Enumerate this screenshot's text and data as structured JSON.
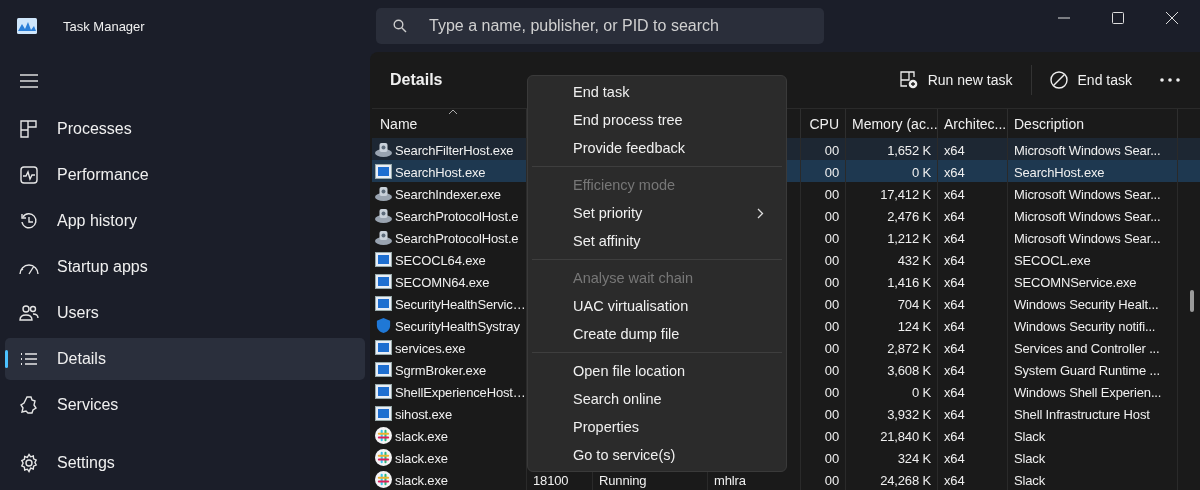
{
  "window": {
    "title": "Task Manager"
  },
  "search": {
    "placeholder": "Type a name, publisher, or PID to search"
  },
  "sidebar": {
    "items": [
      {
        "label": "Processes",
        "selected": false
      },
      {
        "label": "Performance",
        "selected": false
      },
      {
        "label": "App history",
        "selected": false
      },
      {
        "label": "Startup apps",
        "selected": false
      },
      {
        "label": "Users",
        "selected": false
      },
      {
        "label": "Details",
        "selected": true
      },
      {
        "label": "Services",
        "selected": false
      }
    ],
    "footer": {
      "label": "Settings"
    }
  },
  "page": {
    "title": "Details",
    "actions": [
      {
        "label": "Run new task"
      },
      {
        "label": "End task"
      }
    ]
  },
  "table": {
    "headers": {
      "name": {
        "label": "Name",
        "sorted": true
      },
      "cpu": {
        "label": "CPU"
      },
      "memory": {
        "label": "Memory (ac..."
      },
      "arch": {
        "label": "Architec..."
      },
      "description": {
        "label": "Description"
      }
    },
    "rows": [
      {
        "kind": "service",
        "name": "SearchFilterHost.exe",
        "cpu": "00",
        "memory": "1,652 K",
        "arch": "x64",
        "description": "Microsoft Windows Sear...",
        "selected": false,
        "hovered": true
      },
      {
        "kind": "window",
        "name": "SearchHost.exe",
        "cpu": "00",
        "memory": "0 K",
        "arch": "x64",
        "description": "SearchHost.exe",
        "selected": true,
        "hovered": false
      },
      {
        "kind": "service",
        "name": "SearchIndexer.exe",
        "cpu": "00",
        "memory": "17,412 K",
        "arch": "x64",
        "description": "Microsoft Windows Sear...",
        "selected": false,
        "hovered": false
      },
      {
        "kind": "service",
        "name": "SearchProtocolHost.e",
        "cpu": "00",
        "memory": "2,476 K",
        "arch": "x64",
        "description": "Microsoft Windows Sear...",
        "selected": false,
        "hovered": false
      },
      {
        "kind": "service",
        "name": "SearchProtocolHost.e",
        "cpu": "00",
        "memory": "1,212 K",
        "arch": "x64",
        "description": "Microsoft Windows Sear...",
        "selected": false,
        "hovered": false
      },
      {
        "kind": "window",
        "name": "SECOCL64.exe",
        "cpu": "00",
        "memory": "432 K",
        "arch": "x64",
        "description": "SECOCL.exe",
        "selected": false,
        "hovered": false
      },
      {
        "kind": "window",
        "name": "SECOMN64.exe",
        "cpu": "00",
        "memory": "1,416 K",
        "arch": "x64",
        "description": "SECOMNService.exe",
        "selected": false,
        "hovered": false
      },
      {
        "kind": "window",
        "name": "SecurityHealthServic…",
        "cpu": "00",
        "memory": "704 K",
        "arch": "x64",
        "description": "Windows Security Healt...",
        "selected": false,
        "hovered": false
      },
      {
        "kind": "shield",
        "name": "SecurityHealthSystray",
        "cpu": "00",
        "memory": "124 K",
        "arch": "x64",
        "description": "Windows Security notifi...",
        "selected": false,
        "hovered": false
      },
      {
        "kind": "window",
        "name": "services.exe",
        "cpu": "00",
        "memory": "2,872 K",
        "arch": "x64",
        "description": "Services and Controller ...",
        "selected": false,
        "hovered": false
      },
      {
        "kind": "window",
        "name": "SgrmBroker.exe",
        "cpu": "00",
        "memory": "3,608 K",
        "arch": "x64",
        "description": "System Guard Runtime ...",
        "selected": false,
        "hovered": false
      },
      {
        "kind": "window",
        "name": "ShellExperienceHost…",
        "cpu": "00",
        "memory": "0 K",
        "arch": "x64",
        "description": "Windows Shell Experien...",
        "selected": false,
        "hovered": false
      },
      {
        "kind": "window",
        "name": "sihost.exe",
        "cpu": "00",
        "memory": "3,932 K",
        "arch": "x64",
        "description": "Shell Infrastructure Host",
        "selected": false,
        "hovered": false
      },
      {
        "kind": "slack",
        "name": "slack.exe",
        "cpu": "00",
        "memory": "21,840 K",
        "arch": "x64",
        "description": "Slack",
        "selected": false,
        "hovered": false
      },
      {
        "kind": "slack",
        "name": "slack.exe",
        "cpu": "00",
        "memory": "324 K",
        "arch": "x64",
        "description": "Slack",
        "selected": false,
        "hovered": false
      },
      {
        "kind": "slack",
        "name": "slack.exe",
        "pid": "18100",
        "status": "Running",
        "user": "mhlra",
        "cpu": "00",
        "memory": "24,268 K",
        "arch": "x64",
        "description": "Slack",
        "selected": false,
        "hovered": false
      }
    ]
  },
  "context_menu": {
    "items": [
      {
        "kind": "item",
        "label": "End task",
        "disabled": false,
        "submenu": false
      },
      {
        "kind": "item",
        "label": "End process tree",
        "disabled": false,
        "submenu": false
      },
      {
        "kind": "item",
        "label": "Provide feedback",
        "disabled": false,
        "submenu": false
      },
      {
        "kind": "separator"
      },
      {
        "kind": "item",
        "label": "Efficiency mode",
        "disabled": true,
        "submenu": false
      },
      {
        "kind": "item",
        "label": "Set priority",
        "disabled": false,
        "submenu": true
      },
      {
        "kind": "item",
        "label": "Set affinity",
        "disabled": false,
        "submenu": false
      },
      {
        "kind": "separator"
      },
      {
        "kind": "item",
        "label": "Analyse wait chain",
        "disabled": true,
        "submenu": false
      },
      {
        "kind": "item",
        "label": "UAC virtualisation",
        "disabled": false,
        "submenu": false
      },
      {
        "kind": "item",
        "label": "Create dump file",
        "disabled": false,
        "submenu": false
      },
      {
        "kind": "separator"
      },
      {
        "kind": "item",
        "label": "Open file location",
        "disabled": false,
        "submenu": false
      },
      {
        "kind": "item",
        "label": "Search online",
        "disabled": false,
        "submenu": false
      },
      {
        "kind": "item",
        "label": "Properties",
        "disabled": false,
        "submenu": false
      },
      {
        "kind": "item",
        "label": "Go to service(s)",
        "disabled": false,
        "submenu": false
      }
    ]
  }
}
